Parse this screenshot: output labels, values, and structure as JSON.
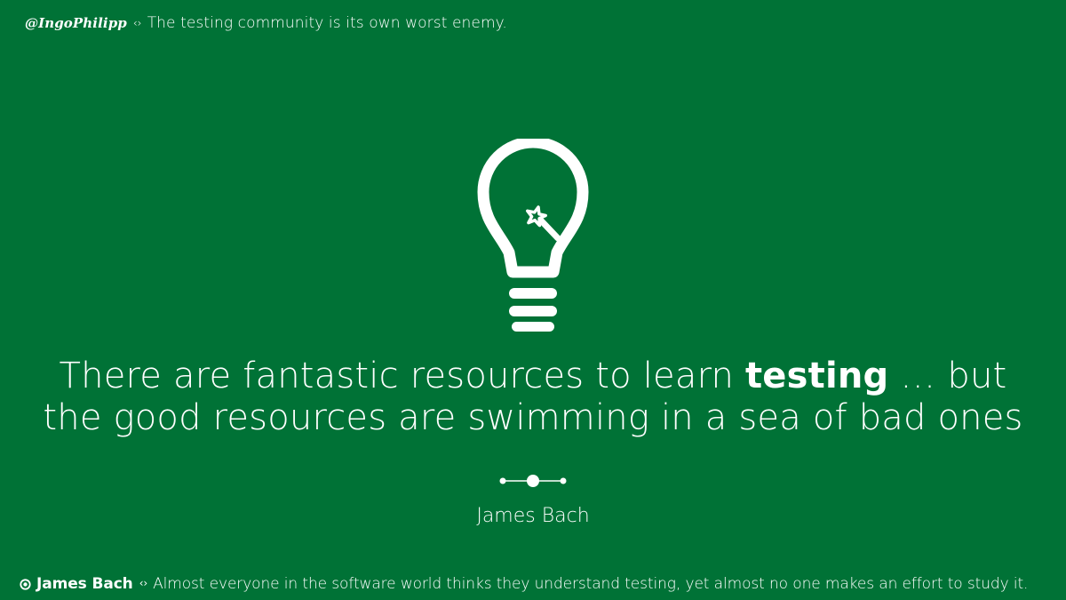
{
  "header": {
    "handle": "@IngoPhilipp",
    "separator": "‹›",
    "tagline": "The testing community is its own worst enemy."
  },
  "quote": {
    "line1_start": "There are fantastic resources to learn ",
    "line1_emphasis": "testing",
    "line1_end": " … but",
    "line2": "the good resources are swimming in a sea of bad ones"
  },
  "attribution": {
    "author": "James Bach"
  },
  "footer": {
    "name": "James Bach",
    "separator": "‹›",
    "text": "Almost everyone in the software world thinks they understand testing, yet almost no one makes an effort to study it."
  },
  "colors": {
    "background": "#007236",
    "foreground": "#ffffff"
  },
  "icons": {
    "main": "lightbulb-wand-icon",
    "divider": "dot-line-divider-icon",
    "footer": "target-icon"
  }
}
